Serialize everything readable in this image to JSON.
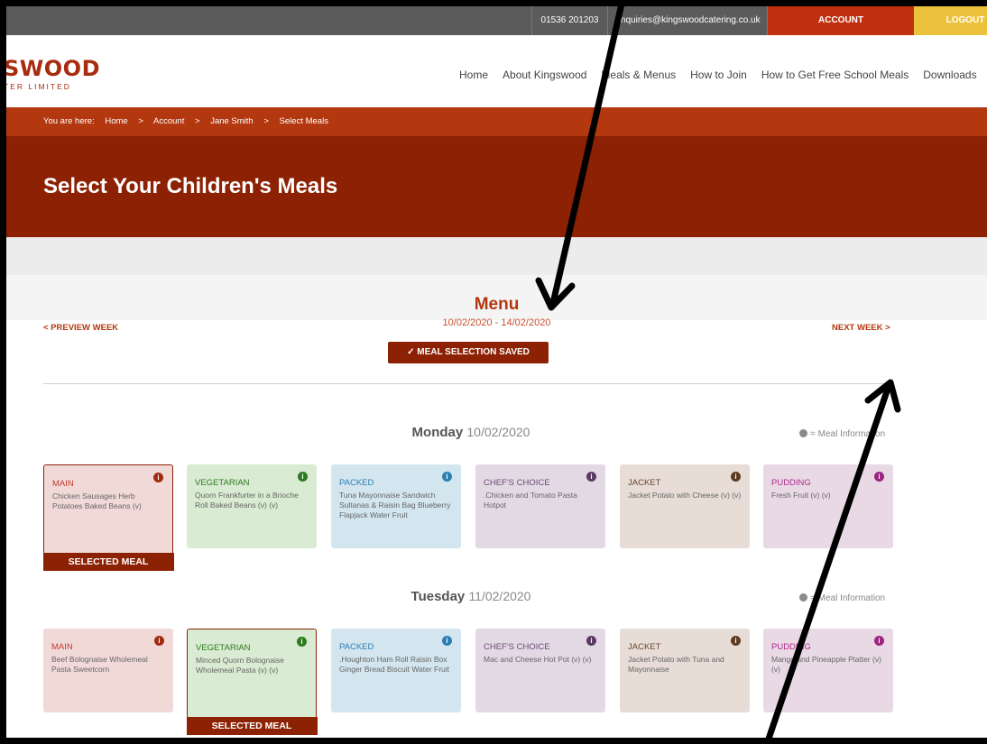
{
  "topbar": {
    "phone": "01536 201203",
    "email": "enquiries@kingswoodcatering.co.uk",
    "account": "ACCOUNT",
    "logout": "LOGOUT"
  },
  "logo": {
    "main": "SWOOD",
    "sub": "TER LIMITED"
  },
  "nav": [
    "Home",
    "About Kingswood",
    "Meals & Menus",
    "How to Join",
    "How to Get Free School Meals",
    "Downloads"
  ],
  "breadcrumb": [
    "You are here:",
    "Home",
    ">",
    "Account",
    ">",
    "Jane Smith",
    ">",
    "Select Meals"
  ],
  "hero": {
    "title": "Select Your Children's Meals"
  },
  "menu": {
    "title": "Menu",
    "dates": "10/02/2020 - 14/02/2020",
    "prev_week": "< PREVIEW WEEK",
    "next_week": "NEXT WEEK >",
    "saved": "✓ MEAL SELECTION SAVED"
  },
  "legend": "= Meal Information",
  "days": [
    {
      "name": "Monday",
      "date": "10/02/2020",
      "meals": [
        {
          "category": "MAIN",
          "desc": "Chicken Sausages Herb Potatoes Baked Beans (v)",
          "selected": true
        },
        {
          "category": "VEGETARIAN",
          "desc": "Quorn Frankfurter in a Brioche Roll Baked Beans (v) (v)",
          "selected": false
        },
        {
          "category": "PACKED",
          "desc": "Tuna Mayonnaise Sandwich Sultanas & Raisin Bag Blueberry Flapjack Water Fruit",
          "selected": false
        },
        {
          "category": "CHEF'S CHOICE",
          "desc": ".Chicken and Tomato Pasta Hotpot",
          "selected": false
        },
        {
          "category": "JACKET",
          "desc": "Jacket Potato with Cheese (v) (v)",
          "selected": false
        },
        {
          "category": "PUDDING",
          "desc": "Fresh Fruit (v) (v)",
          "selected": false
        }
      ]
    },
    {
      "name": "Tuesday",
      "date": "11/02/2020",
      "meals": [
        {
          "category": "MAIN",
          "desc": "Beef Bolognaise Wholemeal Pasta Sweetcorn",
          "selected": false
        },
        {
          "category": "VEGETARIAN",
          "desc": "Minced Quorn Bolognaise Wholemeal Pasta (v) (v)",
          "selected": true
        },
        {
          "category": "PACKED",
          "desc": ".Houghton Ham Roll Raisin Box Ginger Bread Biscuit Water Fruit",
          "selected": false
        },
        {
          "category": "CHEF'S CHOICE",
          "desc": "Mac and Cheese Hot Pot (v) (v)",
          "selected": false
        },
        {
          "category": "JACKET",
          "desc": "Jacket Potato with Tuna and Mayonnaise",
          "selected": false
        },
        {
          "category": "PUDDING",
          "desc": "Mango and Pineapple Platter (v) (v)",
          "selected": false
        }
      ]
    }
  ],
  "selected_label": "SELECTED MEAL",
  "info_glyph": "i"
}
